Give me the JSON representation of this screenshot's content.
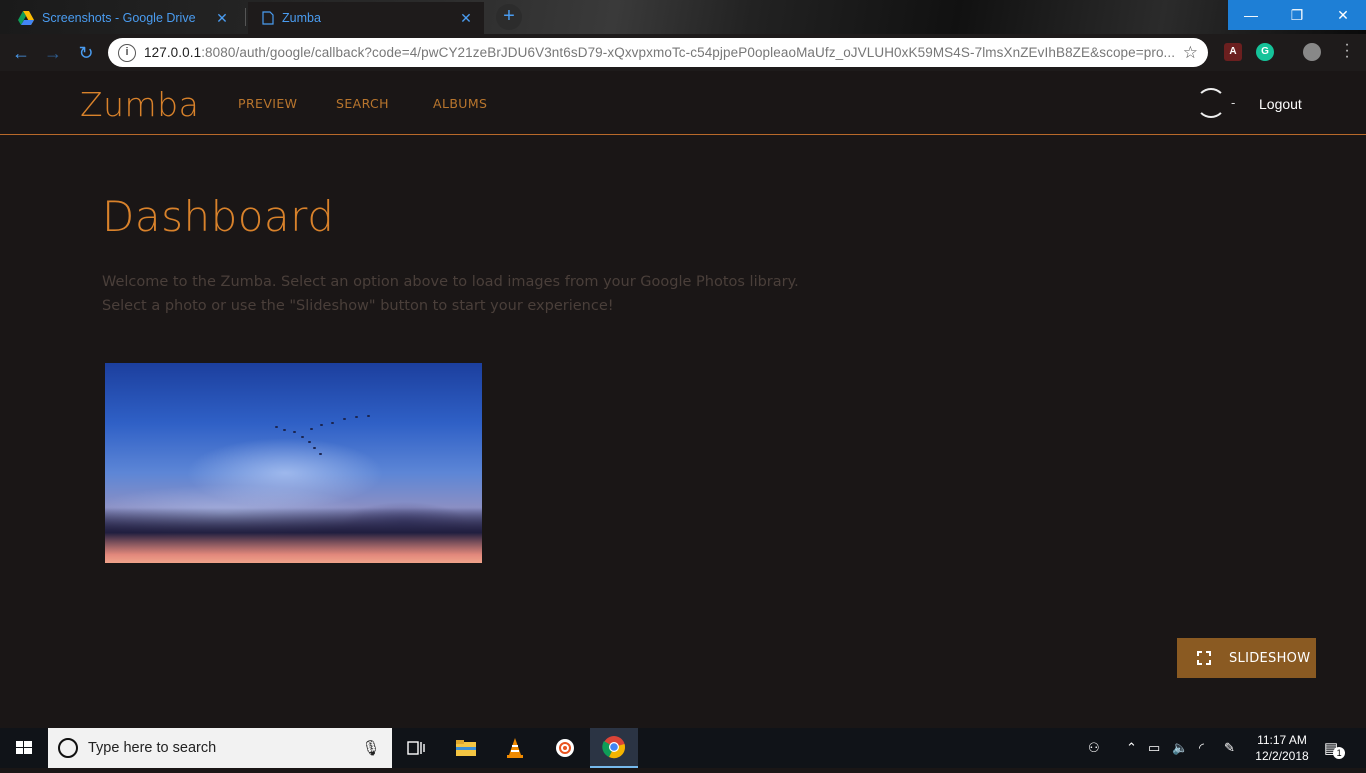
{
  "browser": {
    "tabs": [
      {
        "label": "Screenshots - Google Drive",
        "icon": "google-drive-icon"
      },
      {
        "label": "Zumba",
        "icon": "page-icon"
      }
    ],
    "url_host": "127.0.0.1",
    "url_rest": ":8080/auth/google/callback?code=4/pwCY21zeBrJDU6V3nt6sD79-xQxvpxmoTc-c54pjpeP0opleaoMaUfz_oJVLUH0xK59MS4S-7lmsXnZEvIhB8ZE&scope=pro...",
    "window_buttons": {
      "minimize": "—",
      "restore": "❐",
      "close": "✕"
    }
  },
  "app": {
    "brand": "Zumba",
    "nav": [
      "PREVIEW",
      "SEARCH",
      "ALBUMS"
    ],
    "user_separator": "-",
    "logout": "Logout",
    "page_title": "Dashboard",
    "description_line1": "Welcome to the Zumba. Select an option above to load images from your Google Photos library.",
    "description_line2": "Select a photo or use the \"Slideshow\" button to start your experience!",
    "slideshow_label": "SLIDESHOW",
    "colors": {
      "accent": "#d9822b",
      "button": "#8a5a22",
      "background": "#1a1616"
    }
  },
  "taskbar": {
    "search_placeholder": "Type here to search",
    "time": "11:17 AM",
    "date": "12/2/2018",
    "notification_count": "1"
  }
}
